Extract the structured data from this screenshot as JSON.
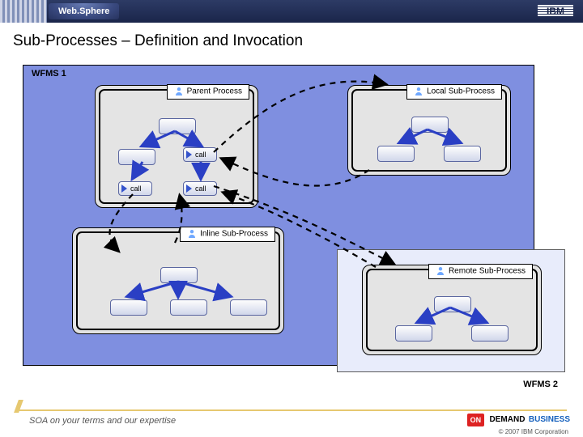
{
  "header": {
    "product": "Web.Sphere",
    "company_logo": "IBM"
  },
  "title": "Sub-Processes – Definition and Invocation",
  "wfms1_label": "WFMS 1",
  "wfms2_label": "WFMS 2",
  "panels": {
    "parent": "Parent Process",
    "local": "Local Sub-Process",
    "inline": "Inline Sub-Process",
    "remote": "Remote Sub-Process"
  },
  "labels": {
    "call": "call"
  },
  "footer": {
    "tagline": "SOA on your terms and our expertise",
    "ondemand_brand": "ON",
    "ondemand_word1": "DEMAND",
    "ondemand_word2": "BUSINESS",
    "copyright": "© 2007 IBM Corporation"
  },
  "colors": {
    "wfms1_bg": "#7f8fe0",
    "wfms2_bg": "#e8ecfb",
    "accent_gold": "#e6c870"
  }
}
